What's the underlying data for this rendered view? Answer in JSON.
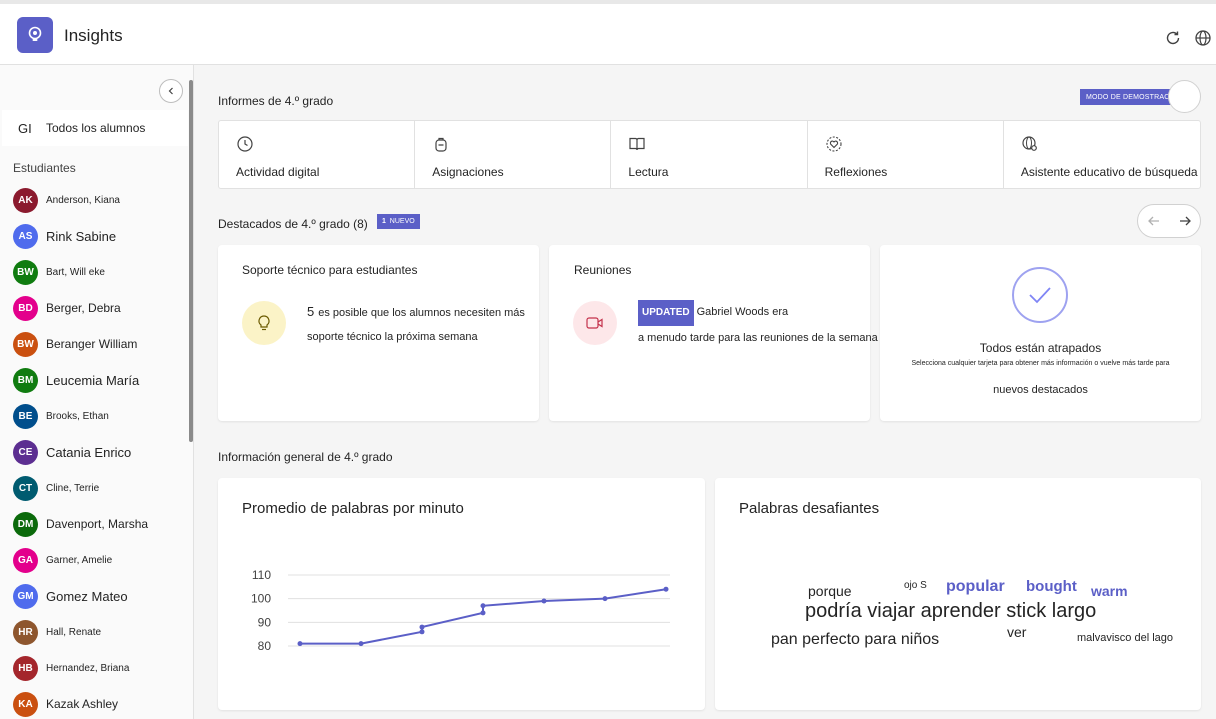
{
  "app": {
    "title": "Insights",
    "logo_icon": "lightbulb-icon"
  },
  "header_icons": [
    "refresh-icon",
    "globe-icon"
  ],
  "sidebar": {
    "all_students": {
      "initials": "GI",
      "label": "Todos los alumnos"
    },
    "students_heading": "Estudiantes",
    "students": [
      {
        "initials": "AK",
        "name": "Anderson, Kiana",
        "color": "#8b1a2e",
        "size": "small"
      },
      {
        "initials": "AS",
        "name": "Rink Sabine",
        "color": "#4f6bed",
        "size": "big"
      },
      {
        "initials": "BW",
        "name": "Bart, Will eke",
        "color": "#107c10",
        "size": "small"
      },
      {
        "initials": "BD",
        "name": "Berger, Debra",
        "color": "#e3008c",
        "size": "normal"
      },
      {
        "initials": "BW",
        "name": "Beranger William",
        "color": "#ca5010",
        "size": "normal"
      },
      {
        "initials": "BM",
        "name": "Leucemia María",
        "color": "#107c10",
        "size": "big"
      },
      {
        "initials": "BE",
        "name": "Brooks, Ethan",
        "color": "#004e8c",
        "size": "small"
      },
      {
        "initials": "CE",
        "name": "Catania Enrico",
        "color": "#5c2e91",
        "size": "big"
      },
      {
        "initials": "CT",
        "name": "Cline, Terrie",
        "color": "#005b70",
        "size": "small"
      },
      {
        "initials": "DM",
        "name": "Davenport, Marsha",
        "color": "#0b6a0b",
        "size": "normal"
      },
      {
        "initials": "GA",
        "name": "Garner, Amelie",
        "color": "#e3008c",
        "size": "small"
      },
      {
        "initials": "GM",
        "name": "Gomez Mateo",
        "color": "#4f6bed",
        "size": "big"
      },
      {
        "initials": "HR",
        "name": "Hall, Renate",
        "color": "#8e562e",
        "size": "small"
      },
      {
        "initials": "HB",
        "name": "Hernandez, Briana",
        "color": "#a4262c",
        "size": "small"
      },
      {
        "initials": "KA",
        "name": "Kazak Ashley",
        "color": "#ca5010",
        "size": "normal"
      }
    ]
  },
  "reports": {
    "title": "Informes de 4.º grado",
    "demo_badge": "MODO DE DEMOSTRACIÓN",
    "tabs": [
      {
        "label": "Actividad digital",
        "icon": "clock-icon"
      },
      {
        "label": "Asignaciones",
        "icon": "backpack-icon"
      },
      {
        "label": "Lectura",
        "icon": "book-icon"
      },
      {
        "label": "Reflexiones",
        "icon": "heart-icon"
      },
      {
        "label": "Asistente educativo de búsqueda",
        "icon": "globe-search-icon"
      }
    ]
  },
  "highlights": {
    "title": "Destacados de 4.º grado (8)",
    "new_count": "1",
    "new_label": "NUEVO",
    "cards": {
      "support": {
        "title": "Soporte técnico para estudiantes",
        "number": "5",
        "line1": "es posible que los alumnos necesiten más",
        "line2": "soporte técnico la próxima semana"
      },
      "meetings": {
        "title": "Reuniones",
        "badge": "UPDATED",
        "line1": "Gabriel Woods era",
        "line2": "a menudo tarde para las reuniones de la semana pasada"
      },
      "caught_up": {
        "title": "Todos están atrapados",
        "desc": "Selecciona cualquier tarjeta para obtener más información o vuelve más tarde para",
        "desc2": "nuevos destacados"
      }
    }
  },
  "overview": {
    "title": "Información general de 4.º grado",
    "wpm_title": "Promedio de palabras por minuto",
    "words_title": "Palabras desafiantes",
    "words": [
      {
        "text": "porque",
        "size": 14,
        "accent": false
      },
      {
        "text": "ojo S",
        "size": 10,
        "accent": false
      },
      {
        "text": "popular",
        "size": 16,
        "accent": true
      },
      {
        "text": "bought",
        "size": 15,
        "accent": true
      },
      {
        "text": "warm",
        "size": 14,
        "accent": true
      },
      {
        "text": "podría viajar aprender stick largo",
        "size": 20,
        "accent": false
      },
      {
        "text": "ver",
        "size": 14,
        "accent": false
      },
      {
        "text": "pan perfecto para niños",
        "size": 16,
        "accent": false
      },
      {
        "text": "malvavisco del lago",
        "size": 11,
        "accent": false
      }
    ]
  },
  "chart_data": {
    "type": "line",
    "title": "Promedio de palabras por minuto",
    "xlabel": "",
    "ylabel": "",
    "yticks": [
      80,
      90,
      100,
      110
    ],
    "ylim": [
      75,
      112
    ],
    "x": [
      1,
      2,
      3,
      3,
      4,
      4,
      5,
      6,
      7
    ],
    "y": [
      81,
      81,
      86,
      88,
      94,
      97,
      99,
      100,
      104
    ],
    "color": "#5b5fc7"
  }
}
